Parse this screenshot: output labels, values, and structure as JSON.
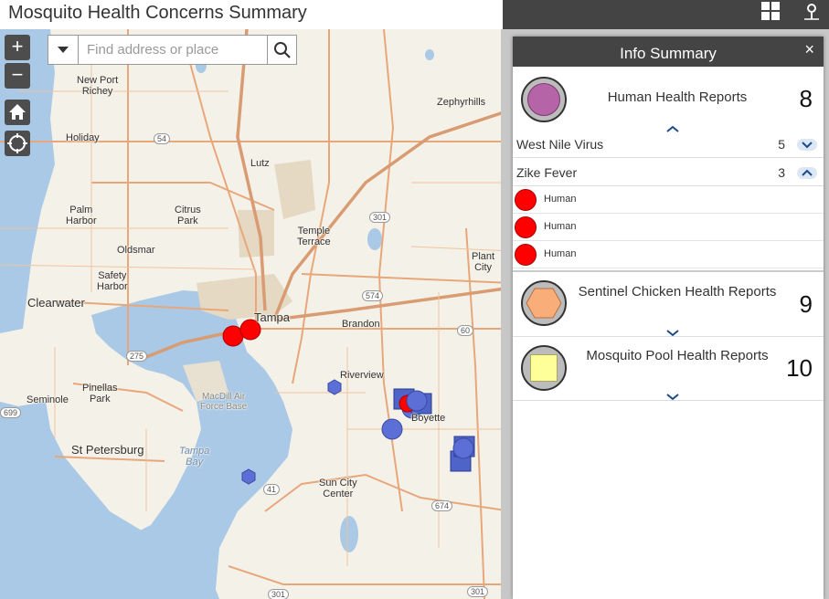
{
  "header": {
    "title": "Mosquito Health Concerns Summary",
    "icons": [
      "grid-icon",
      "map-pin-icon"
    ]
  },
  "map_controls": {
    "zoom_in": "+",
    "zoom_out": "−",
    "home_icon": "home-icon",
    "locate_icon": "locate-icon"
  },
  "search": {
    "placeholder": "Find address or place",
    "value": ""
  },
  "places": [
    {
      "id": "new-port-richey",
      "text": "New Port\nRichey"
    },
    {
      "id": "zephyrhills",
      "text": "Zephyrhills"
    },
    {
      "id": "holiday",
      "text": "Holiday"
    },
    {
      "id": "lutz",
      "text": "Lutz"
    },
    {
      "id": "palm-harbor",
      "text": "Palm\nHarbor"
    },
    {
      "id": "citrus-park",
      "text": "Citrus\nPark"
    },
    {
      "id": "temple-terrace",
      "text": "Temple\nTerrace"
    },
    {
      "id": "oldsmar",
      "text": "Oldsmar"
    },
    {
      "id": "plant-city",
      "text": "Plant\nCity"
    },
    {
      "id": "safety-harbor",
      "text": "Safety\nHarbor"
    },
    {
      "id": "clearwater",
      "text": "Clearwater"
    },
    {
      "id": "tampa",
      "text": "Tampa"
    },
    {
      "id": "brandon",
      "text": "Brandon"
    },
    {
      "id": "riverview",
      "text": "Riverview"
    },
    {
      "id": "pinellas-park",
      "text": "Pinellas\nPark"
    },
    {
      "id": "macdill",
      "text": "MacDill Air\nForce Base"
    },
    {
      "id": "seminole",
      "text": "Seminole"
    },
    {
      "id": "boyette",
      "text": "Boyette"
    },
    {
      "id": "st-petersburg",
      "text": "St Petersburg"
    },
    {
      "id": "tampa-bay",
      "text": "Tampa\nBay"
    },
    {
      "id": "sun-city-center",
      "text": "Sun City\nCenter"
    }
  ],
  "road_shields": [
    "54",
    "301",
    "574",
    "60",
    "275",
    "41",
    "674",
    "699",
    "301",
    "301"
  ],
  "info_panel": {
    "title": "Info Summary",
    "close": "×",
    "summaries": [
      {
        "label": "Human Health Reports",
        "count": "8",
        "symbol": "purple-circle",
        "color": "#b564a8",
        "expanded": true
      },
      {
        "label": "Sentinel Chicken Health Reports",
        "count": "9",
        "symbol": "orange-hexagon",
        "color": "#f9ad79",
        "expanded": false
      },
      {
        "label": "Mosquito Pool Health Reports",
        "count": "10",
        "symbol": "yellow-square",
        "color": "#ffff9a",
        "expanded": false
      }
    ],
    "human_groups": [
      {
        "label": "West Nile Virus",
        "count": "5",
        "expanded": false
      },
      {
        "label": "Zike Fever",
        "count": "3",
        "expanded": true
      }
    ],
    "zike_features": [
      {
        "label": "Human"
      },
      {
        "label": "Human"
      },
      {
        "label": "Human"
      }
    ]
  },
  "colors": {
    "header_bg": "#444444",
    "human_marker": "#ff0000",
    "chicken_marker": "#5b6fd6",
    "pool_marker": "#4f64c8",
    "water": "#a9c9e6",
    "land": "#f4f1e8"
  }
}
